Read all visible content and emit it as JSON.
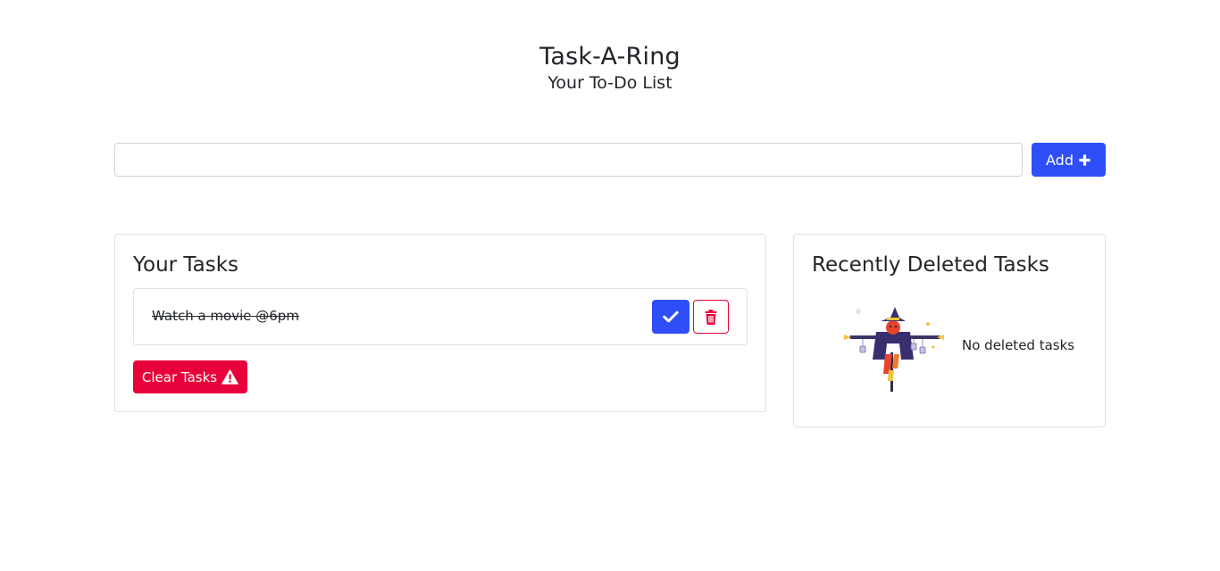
{
  "header": {
    "title": "Task-A-Ring",
    "subtitle": "Your To-Do List"
  },
  "input": {
    "value": "",
    "placeholder": ""
  },
  "add_button": {
    "label": "Add",
    "icon": "plus-icon"
  },
  "tasks_panel": {
    "title": "Your Tasks",
    "tasks": [
      {
        "text": "Watch a movie @6pm",
        "completed": true
      }
    ],
    "clear_button": {
      "label": "Clear Tasks",
      "icon": "warning-icon"
    }
  },
  "deleted_panel": {
    "title": "Recently Deleted Tasks",
    "empty_text": "No deleted tasks",
    "illustration": "scarecrow-illustration"
  },
  "colors": {
    "primary": "#2f4ef7",
    "danger": "#e8003a",
    "border": "#dee2e6",
    "text": "#212529"
  }
}
